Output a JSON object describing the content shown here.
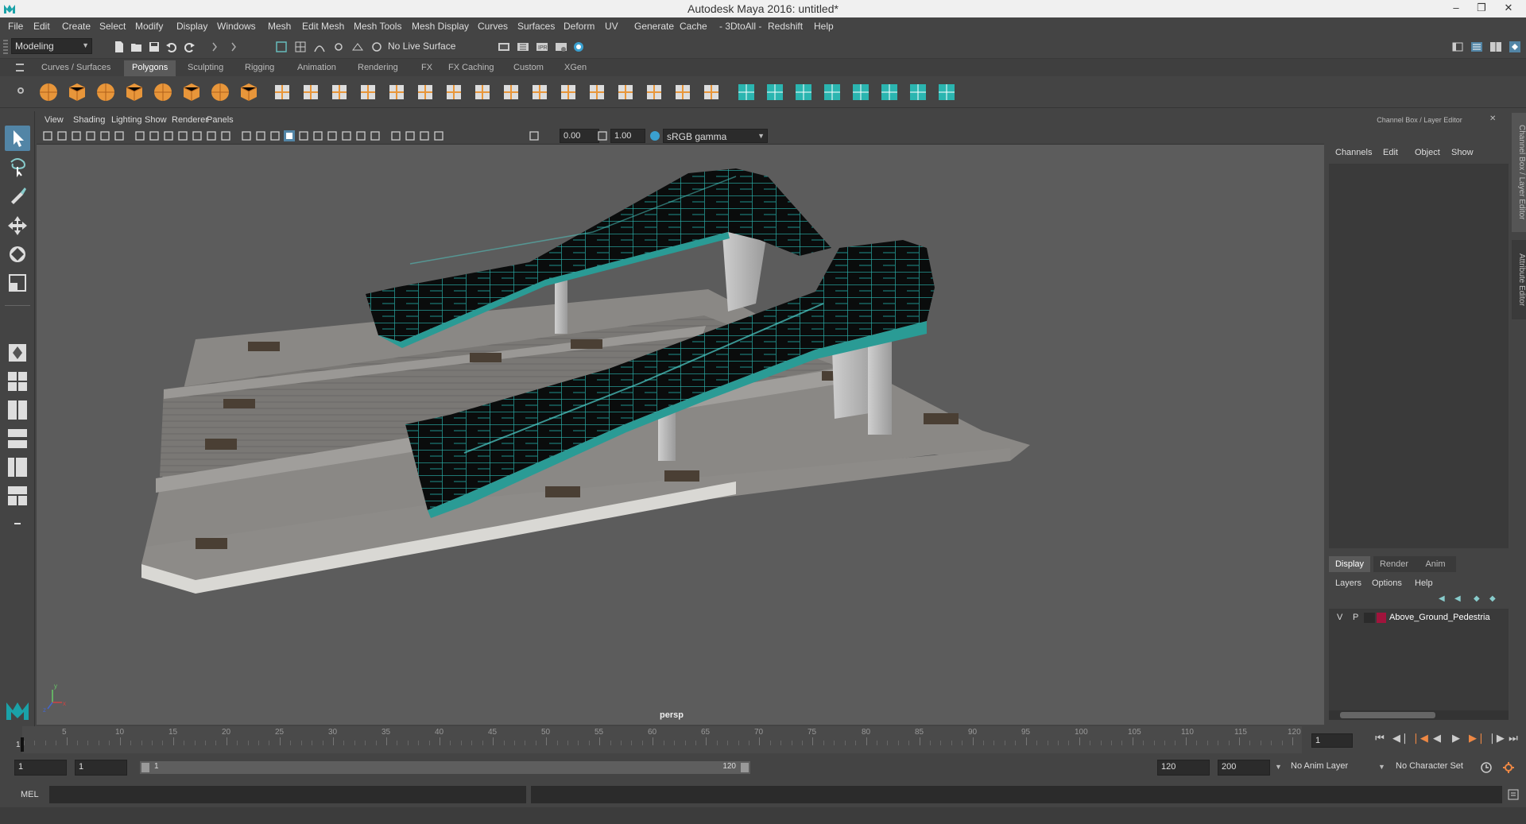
{
  "window": {
    "title": "Autodesk Maya 2016: untitled*",
    "minimize": "–",
    "restore": "❐",
    "close": "✕"
  },
  "menubar": [
    "File",
    "Edit",
    "Create",
    "Select",
    "Modify",
    "Display",
    "Windows",
    "Mesh",
    "Edit Mesh",
    "Mesh Tools",
    "Mesh Display",
    "Curves",
    "Surfaces",
    "Deform",
    "UV",
    "Generate",
    "Cache",
    "- 3DtoAll -",
    "Redshift",
    "Help"
  ],
  "statusline": {
    "mode": "Modeling",
    "live_surface": "No Live Surface"
  },
  "shelf_tabs": [
    "Curves / Surfaces",
    "Polygons",
    "Sculpting",
    "Rigging",
    "Animation",
    "Rendering",
    "FX",
    "FX Caching",
    "Custom",
    "XGen"
  ],
  "shelf_active": "Polygons",
  "panel_menu": [
    "View",
    "Shading",
    "Lighting",
    "Show",
    "Renderer",
    "Panels"
  ],
  "panel_toolbar": {
    "exposure": "0.00",
    "gamma": "1.00",
    "color_space": "sRGB gamma"
  },
  "viewport": {
    "camera_label": "persp"
  },
  "channel_box": {
    "header": "Channel Box / Layer Editor",
    "menu": [
      "Channels",
      "Edit",
      "Object",
      "Show"
    ]
  },
  "layer_editor": {
    "tabs": [
      "Display",
      "Render",
      "Anim"
    ],
    "active_tab": "Display",
    "menu": [
      "Layers",
      "Options",
      "Help"
    ],
    "layers": [
      {
        "v": "V",
        "p": "P",
        "color": "#a0143c",
        "name": "Above_Ground_Pedestria"
      }
    ]
  },
  "side_tabs": [
    "Channel Box / Layer Editor",
    "Attribute Editor"
  ],
  "timeslider": {
    "ticks": [
      5,
      10,
      15,
      20,
      25,
      30,
      35,
      40,
      45,
      50,
      55,
      60,
      65,
      70,
      75,
      80,
      85,
      90,
      95,
      100,
      105,
      110,
      115,
      120
    ],
    "start_marker": "1",
    "current_frame": "1"
  },
  "rangeslider": {
    "start": "1",
    "start_inner": "1",
    "range_start": "1",
    "range_end": "120",
    "end": "120",
    "max_end": "200",
    "anim_layer": "No Anim Layer",
    "character_set": "No Character Set"
  },
  "cmdline": {
    "label": "MEL"
  },
  "colors": {
    "accent": "#5285a6",
    "teal": "#2bb5b0",
    "layer_color": "#a0143c"
  }
}
